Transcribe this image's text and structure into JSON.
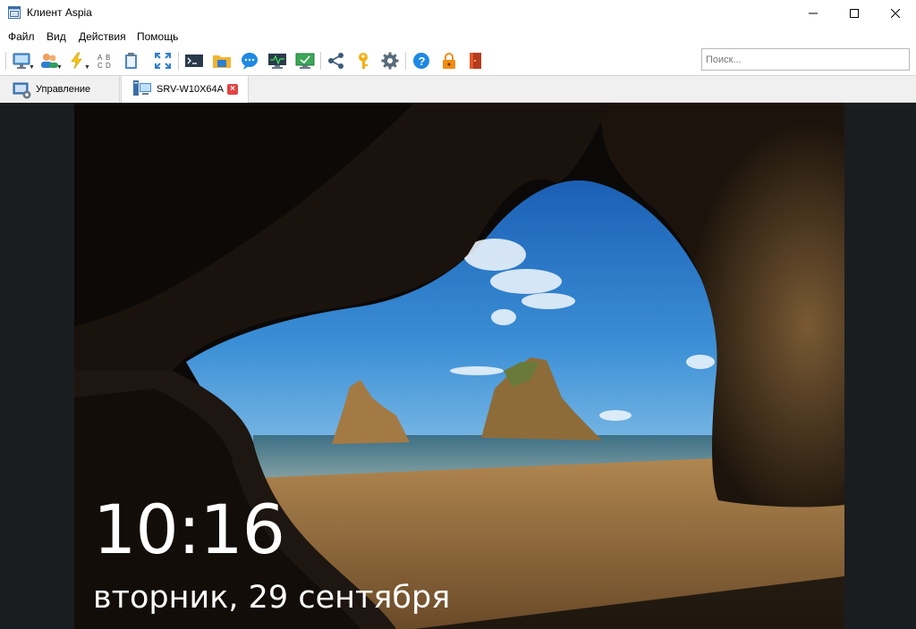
{
  "window": {
    "title": "Клиент Aspia"
  },
  "menu": [
    "Файл",
    "Вид",
    "Действия",
    "Помощь"
  ],
  "toolbar": {
    "buttons": [
      "desktop-connect-icon",
      "users-icon",
      "power-icon",
      "text-chat-icon",
      "clipboard-icon",
      "fullscreen-icon",
      "terminal-icon",
      "folder-icon",
      "chat-bubble-icon",
      "monitor-activity-icon",
      "monitor-check-icon",
      "share-icon",
      "key-icon",
      "settings-icon",
      "help-icon",
      "lock-icon",
      "exit-icon"
    ],
    "search_placeholder": "Поиск..."
  },
  "tabs": [
    {
      "label": "Управление",
      "active": false
    },
    {
      "label": "SRV-W10X64A",
      "active": true,
      "close": "×"
    }
  ],
  "remote_screen": {
    "time": "10:16",
    "date": "вторник, 29 сентября"
  },
  "colors": {
    "accent_blue": "#1e88e5",
    "key_yellow": "#f5b014",
    "lock_orange": "#ef8c14",
    "close_red": "#e04343"
  }
}
